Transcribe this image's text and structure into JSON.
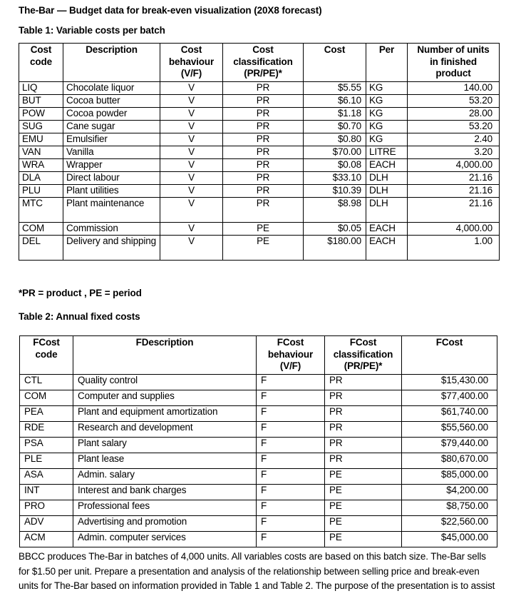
{
  "document": {
    "title": "The-Bar — Budget data for break-even visualization (20X8 forecast)",
    "footnote1": "*PR = product , PE = period",
    "paragraph": "BBCC produces The-Bar in batches of 4,000 units. All variables costs are based on this batch size. The-Bar sells for $1.50 per unit. Prepare a presentation and analysis of the relationship between selling price and break-even units for The-Bar based on information provided in Table 1 and Table 2. The purpose of the presentation is to assist"
  },
  "table1": {
    "caption": "Table 1: Variable costs per batch",
    "headers": {
      "code": "Cost\ncode",
      "description": "Description",
      "behaviour": "Cost\nbehaviour\n(V/F)",
      "classification": "Cost\nclassification\n(PR/PE)*",
      "cost": "Cost",
      "per": "Per",
      "units": "Number of units\nin finished\nproduct"
    },
    "header_lines": {
      "code": [
        "Cost",
        "code"
      ],
      "description": [
        "Description"
      ],
      "behaviour": [
        "Cost",
        "behaviour",
        "(V/F)"
      ],
      "classification": [
        "Cost",
        "classification",
        "(PR/PE)*"
      ],
      "cost": [
        "Cost"
      ],
      "per": [
        "Per"
      ],
      "units": [
        "Number of units",
        "in finished",
        "product"
      ]
    },
    "rows": [
      {
        "code": "LIQ",
        "description": "Chocolate liquor",
        "behaviour": "V",
        "classification": "PR",
        "cost": "$5.55",
        "per": "KG",
        "units": "140.00"
      },
      {
        "code": "BUT",
        "description": "Cocoa butter",
        "behaviour": "V",
        "classification": "PR",
        "cost": "$6.10",
        "per": "KG",
        "units": "53.20"
      },
      {
        "code": "POW",
        "description": "Cocoa powder",
        "behaviour": "V",
        "classification": "PR",
        "cost": "$1.18",
        "per": "KG",
        "units": "28.00"
      },
      {
        "code": "SUG",
        "description": "Cane sugar",
        "behaviour": "V",
        "classification": "PR",
        "cost": "$0.70",
        "per": "KG",
        "units": "53.20"
      },
      {
        "code": "EMU",
        "description": "Emulsifier",
        "behaviour": "V",
        "classification": "PR",
        "cost": "$0.80",
        "per": "KG",
        "units": "2.40"
      },
      {
        "code": "VAN",
        "description": "Vanilla",
        "behaviour": "V",
        "classification": "PR",
        "cost": "$70.00",
        "per": "LITRE",
        "units": "3.20"
      },
      {
        "code": "WRA",
        "description": "Wrapper",
        "behaviour": "V",
        "classification": "PR",
        "cost": "$0.08",
        "per": "EACH",
        "units": "4,000.00"
      },
      {
        "code": "DLA",
        "description": "Direct labour",
        "behaviour": "V",
        "classification": "PR",
        "cost": "$33.10",
        "per": "DLH",
        "units": "21.16"
      },
      {
        "code": "PLU",
        "description": "Plant utilities",
        "behaviour": "V",
        "classification": "PR",
        "cost": "$10.39",
        "per": "DLH",
        "units": "21.16"
      },
      {
        "code": "MTC",
        "description": "Plant maintenance",
        "behaviour": "V",
        "classification": "PR",
        "cost": "$8.98",
        "per": "DLH",
        "units": "21.16",
        "tall": true
      },
      {
        "code": "COM",
        "description": "Commission",
        "behaviour": "V",
        "classification": "PE",
        "cost": "$0.05",
        "per": "EACH",
        "units": "4,000.00"
      },
      {
        "code": "DEL",
        "description": "Delivery and shipping",
        "behaviour": "V",
        "classification": "PE",
        "cost": "$180.00",
        "per": "EACH",
        "units": "1.00",
        "tall": true
      }
    ]
  },
  "table2": {
    "caption": "Table 2: Annual fixed costs",
    "headers": {
      "code": "FCost\ncode",
      "description": "FDescription",
      "behaviour": "FCost\nbehaviour\n(V/F)",
      "classification": "FCost\nclassification\n(PR/PE)*",
      "cost": "FCost"
    },
    "header_lines": {
      "code": [
        "FCost",
        "code"
      ],
      "description": [
        "FDescription"
      ],
      "behaviour": [
        "FCost",
        "behaviour",
        "(V/F)"
      ],
      "classification": [
        "FCost",
        "classification",
        "(PR/PE)*"
      ],
      "cost": [
        "FCost"
      ]
    },
    "rows": [
      {
        "code": "CTL",
        "description": "Quality control",
        "behaviour": "F",
        "classification": "PR",
        "cost": "$15,430.00"
      },
      {
        "code": "COM",
        "description": "Computer and supplies",
        "behaviour": "F",
        "classification": "PR",
        "cost": "$77,400.00"
      },
      {
        "code": "PEA",
        "description": "Plant and equipment amortization",
        "behaviour": "F",
        "classification": "PR",
        "cost": "$61,740.00"
      },
      {
        "code": "RDE",
        "description": "Research and development",
        "behaviour": "F",
        "classification": "PR",
        "cost": "$55,560.00"
      },
      {
        "code": "PSA",
        "description": "Plant salary",
        "behaviour": "F",
        "classification": "PR",
        "cost": "$79,440.00"
      },
      {
        "code": "PLE",
        "description": "Plant lease",
        "behaviour": "F",
        "classification": "PR",
        "cost": "$80,670.00"
      },
      {
        "code": "ASA",
        "description": "Admin. salary",
        "behaviour": "F",
        "classification": "PE",
        "cost": "$85,000.00"
      },
      {
        "code": "INT",
        "description": "Interest and bank charges",
        "behaviour": "F",
        "classification": "PE",
        "cost": "$4,200.00"
      },
      {
        "code": "PRO",
        "description": "Professional fees",
        "behaviour": "F",
        "classification": "PE",
        "cost": "$8,750.00"
      },
      {
        "code": "ADV",
        "description": "Advertising and promotion",
        "behaviour": "F",
        "classification": "PE",
        "cost": "$22,560.00"
      },
      {
        "code": "ACM",
        "description": "Admin. computer services",
        "behaviour": "F",
        "classification": "PE",
        "cost": "$45,000.00"
      }
    ]
  }
}
